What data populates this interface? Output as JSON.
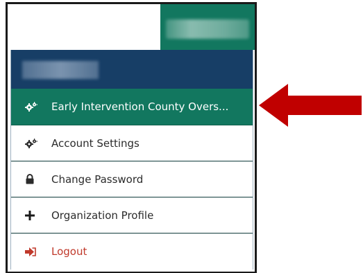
{
  "user_tab": {
    "name_redacted": ""
  },
  "dropdown": {
    "header_redacted": "",
    "items": [
      {
        "label": "Early Intervention County Overs...",
        "icon": "cogs-icon",
        "active": true
      },
      {
        "label": "Account Settings",
        "icon": "cogs-icon",
        "active": false
      },
      {
        "label": "Change Password",
        "icon": "lock-icon",
        "active": false
      },
      {
        "label": "Organization Profile",
        "icon": "plus-icon",
        "active": false
      },
      {
        "label": "Logout",
        "icon": "sign-out-icon",
        "active": false
      }
    ]
  },
  "colors": {
    "accent_green": "#12775f",
    "header_navy": "#173e66",
    "logout_red": "#c0392b",
    "arrow_red": "#c00000"
  }
}
